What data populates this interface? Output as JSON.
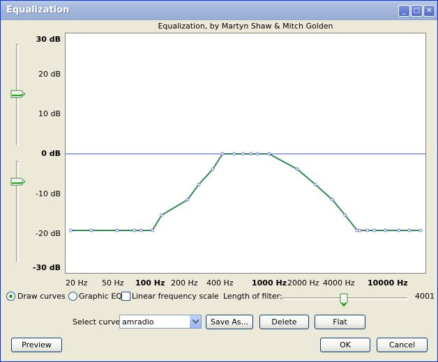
{
  "window": {
    "title": "Equalization"
  },
  "plot": {
    "subtitle": "Equalization, by Martyn Shaw & Mitch Golden",
    "db_labels": [
      "30 dB",
      "20 dB",
      "10 dB",
      "0 dB",
      "-10 dB",
      "-20 dB",
      "-30 dB"
    ],
    "freq_labels": [
      "20 Hz",
      "50 Hz",
      "100 Hz",
      "200 Hz",
      "400 Hz",
      "1000 Hz",
      "2000 Hz",
      "4000 Hz",
      "10000 Hz"
    ]
  },
  "chart_data": {
    "type": "line",
    "xscale": "log",
    "ylim": [
      -30,
      30
    ],
    "x_unit": "Hz",
    "y_unit": "dB",
    "series": [
      {
        "color": "#2e8b57",
        "x": [
          20,
          30,
          50,
          70,
          80,
          100,
          120,
          200,
          250,
          330,
          400,
          500,
          600,
          700,
          800,
          1000,
          1750,
          2500,
          3500,
          4500,
          5700,
          6000,
          7000,
          8000,
          10000,
          13000,
          16000,
          20000
        ],
        "y": [
          -20,
          -20,
          -20,
          -20,
          -20,
          -20,
          -16,
          -12,
          -8,
          -4,
          0,
          0,
          0,
          0,
          0,
          0,
          -4,
          -8,
          -12,
          -16,
          -20,
          -20,
          -20,
          -20,
          -20,
          -20,
          -20,
          -20
        ]
      }
    ],
    "reference_line": 0
  },
  "controls": {
    "draw_curves": "Draw curves",
    "graphic_eq": "Graphic EQ",
    "linear_scale": "Linear frequency scale",
    "filter_length_label": "Length of filter:",
    "filter_length_value": "4001",
    "select_curve_label": "Select curve:",
    "selected_curve": "amradio",
    "save_as": "Save As...",
    "delete": "Delete",
    "flat": "Flat",
    "preview": "Preview",
    "ok": "OK",
    "cancel": "Cancel"
  }
}
